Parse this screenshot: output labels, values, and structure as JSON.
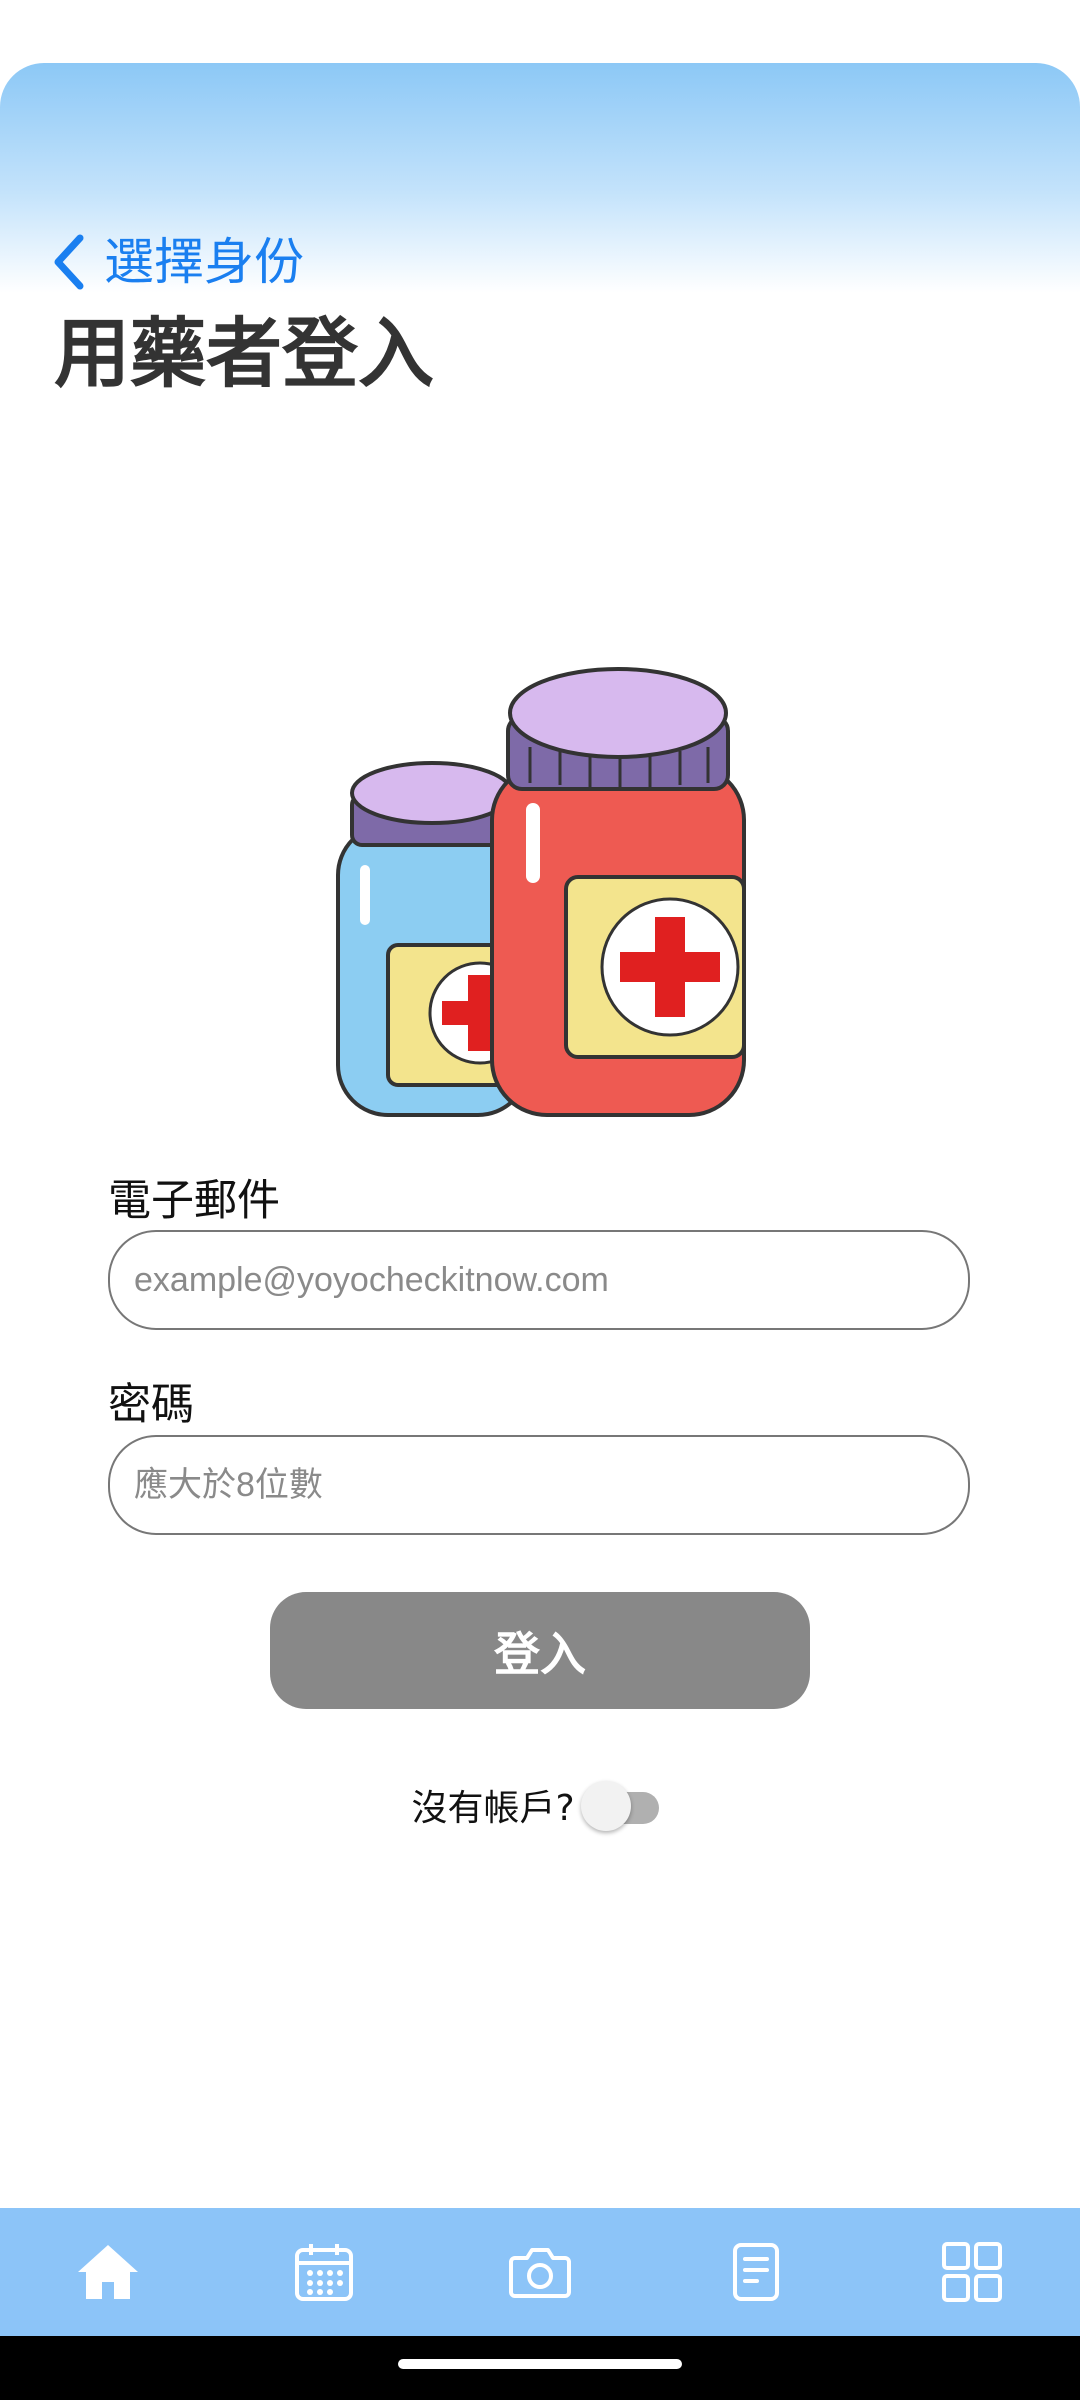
{
  "header": {
    "back_label": "選擇身份",
    "title": "用藥者登入"
  },
  "illustration": {
    "name": "medicine-bottles-icon"
  },
  "form": {
    "email_label": "電子郵件",
    "email_placeholder": "example@yoyocheckitnow.com",
    "email_value": "",
    "password_label": "密碼",
    "password_placeholder": "應大於8位數",
    "password_value": "",
    "login_label": "登入",
    "signup_prompt": "沒有帳戶?",
    "signup_toggle_on": false
  },
  "nav": {
    "items": [
      {
        "icon": "home-icon"
      },
      {
        "icon": "calendar-icon"
      },
      {
        "icon": "camera-icon"
      },
      {
        "icon": "document-icon"
      },
      {
        "icon": "grid-icon"
      }
    ]
  },
  "colors": {
    "accent": "#1a7ff0",
    "nav_background": "#8cc4f8",
    "button_disabled": "#888888",
    "title": "#333333"
  }
}
